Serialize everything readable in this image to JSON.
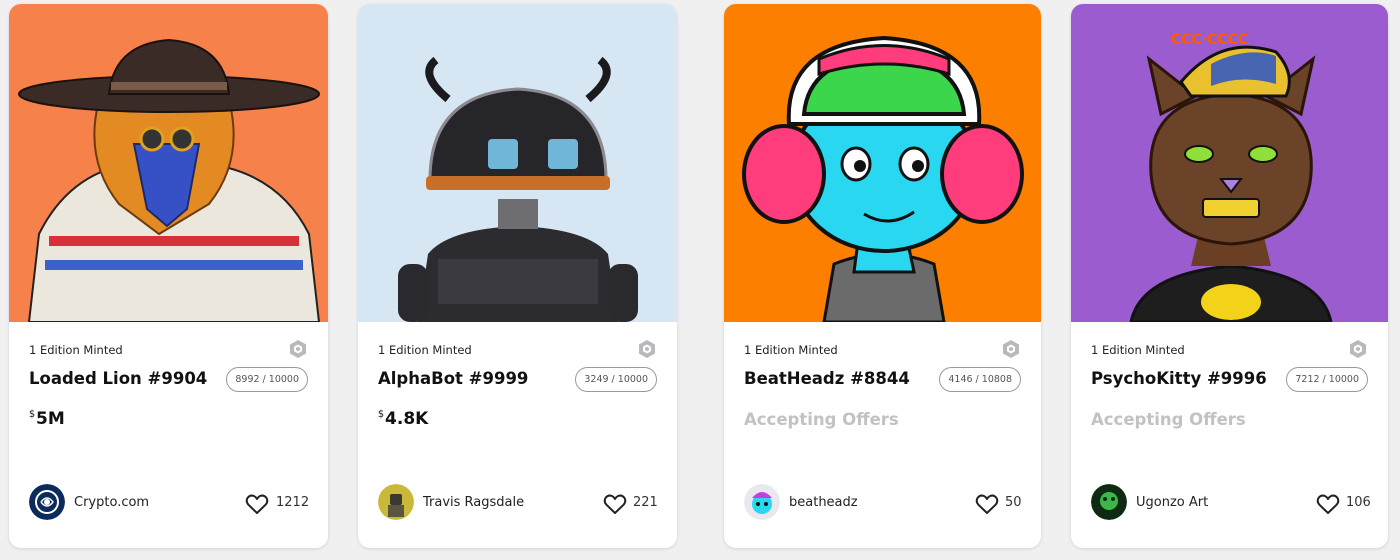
{
  "cards": [
    {
      "edition": "1 Edition Minted",
      "title": "Loaded Lion #9904",
      "supply": "8992 / 10000",
      "price_currency": "$",
      "price": "5M",
      "creator": "Crypto.com",
      "likes": "1212",
      "art_bg": "#f7814a"
    },
    {
      "edition": "1 Edition Minted",
      "title": "AlphaBot #9999",
      "supply": "3249 / 10000",
      "price_currency": "$",
      "price": "4.8K",
      "creator": "Travis Ragsdale",
      "likes": "221",
      "art_bg": "#d6e6f2"
    },
    {
      "edition": "1 Edition Minted",
      "title": "BeatHeadz #8844",
      "supply": "4146 / 10808",
      "status": "Accepting Offers",
      "creator": "beatheadz",
      "likes": "50",
      "art_bg": "#fd7f00"
    },
    {
      "edition": "1 Edition Minted",
      "title": "PsychoKitty #9996",
      "supply": "7212 / 10000",
      "status": "Accepting Offers",
      "creator": "Ugonzo Art",
      "likes": "106",
      "art_bg": "#9a5ccf"
    }
  ],
  "icons": {
    "chain": "hexagon-chain-icon",
    "like": "heart-icon"
  },
  "colors": {
    "accepting_offers": "#c2c2c2",
    "page_bg": "#f0f0f1"
  }
}
